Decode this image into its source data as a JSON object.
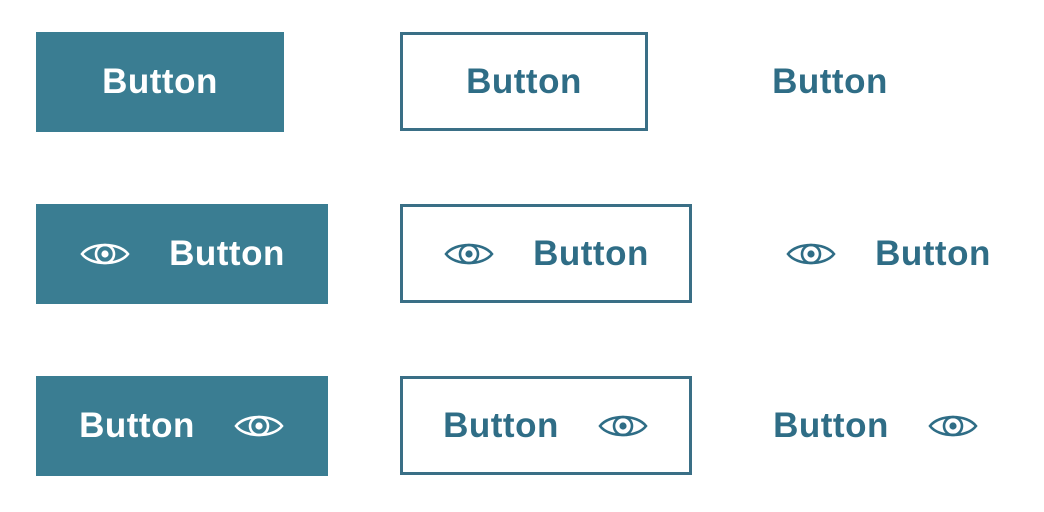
{
  "colors": {
    "primary": "#3a7d92",
    "outline": "#3a6f86",
    "text": "#2f6d86",
    "on_primary": "#ffffff"
  },
  "rows": [
    {
      "variant": "text-only",
      "buttons": [
        {
          "style": "filled",
          "label": "Button"
        },
        {
          "style": "outlined",
          "label": "Button"
        },
        {
          "style": "text",
          "label": "Button"
        }
      ]
    },
    {
      "variant": "icon-leading",
      "icon": "eye-icon",
      "buttons": [
        {
          "style": "filled",
          "label": "Button"
        },
        {
          "style": "outlined",
          "label": "Button"
        },
        {
          "style": "text",
          "label": "Button"
        }
      ]
    },
    {
      "variant": "icon-trailing",
      "icon": "eye-icon",
      "buttons": [
        {
          "style": "filled",
          "label": "Button"
        },
        {
          "style": "outlined",
          "label": "Button"
        },
        {
          "style": "text",
          "label": "Button"
        }
      ]
    }
  ]
}
